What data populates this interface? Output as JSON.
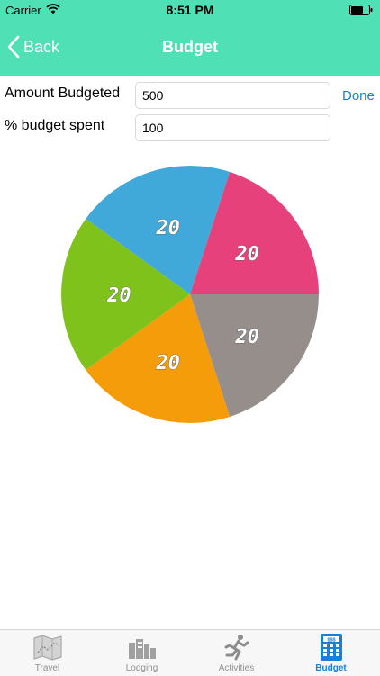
{
  "status_bar": {
    "carrier": "Carrier",
    "time": "8:51 PM"
  },
  "nav": {
    "back_label": "Back",
    "title": "Budget"
  },
  "form": {
    "amount_label": "Amount Budgeted",
    "amount_value": "500",
    "percent_label": "% budget spent",
    "percent_value": "100",
    "done_label": "Done"
  },
  "chart_data": {
    "type": "pie",
    "values": [
      20,
      20,
      20,
      20,
      20
    ],
    "labels": [
      "20",
      "20",
      "20",
      "20",
      "20"
    ],
    "colors": [
      "#41a9da",
      "#e6417a",
      "#968e8a",
      "#f59c0b",
      "#7fc21c"
    ]
  },
  "tabs": [
    {
      "label": "Travel",
      "icon": "map-icon",
      "active": false
    },
    {
      "label": "Lodging",
      "icon": "buildings-icon",
      "active": false
    },
    {
      "label": "Activities",
      "icon": "running-person-icon",
      "active": false
    },
    {
      "label": "Budget",
      "icon": "calculator-icon",
      "active": true
    }
  ],
  "colors": {
    "header": "#4fe0b6",
    "accent": "#1a7fd6"
  }
}
